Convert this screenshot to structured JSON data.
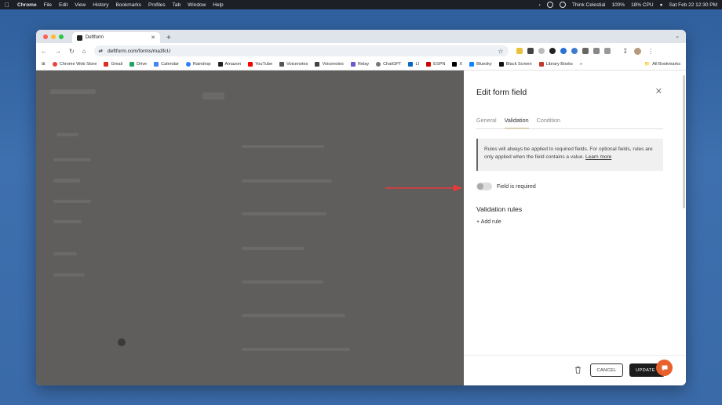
{
  "menubar": {
    "app": "Chrome",
    "items": [
      "File",
      "Edit",
      "View",
      "History",
      "Bookmarks",
      "Profiles",
      "Tab",
      "Window",
      "Help"
    ],
    "user": "Think Celestial",
    "battery": "100%",
    "cpu": "18% CPU",
    "datetime": "Sat Feb 22  12:30 PM"
  },
  "browser": {
    "tab_title": "Deftform",
    "url": "deftform.com/forms/ma3fcU",
    "bookmarks": [
      {
        "label": "Chrome Web Store",
        "color": "#e8453c"
      },
      {
        "label": "Gmail",
        "color": "#d93025"
      },
      {
        "label": "Drive",
        "color": "#1fa463"
      },
      {
        "label": "Calendar",
        "color": "#4285f4"
      },
      {
        "label": "Raindrop",
        "color": "#2d7ff9"
      },
      {
        "label": "Amazon",
        "color": "#222222"
      },
      {
        "label": "YouTube",
        "color": "#ff0000"
      },
      {
        "label": "Voicenotes",
        "color": "#555555"
      },
      {
        "label": "Voicenotes",
        "color": "#444444"
      },
      {
        "label": "Relay",
        "color": "#6a5acd"
      },
      {
        "label": "ChatGPT",
        "color": "#777777"
      },
      {
        "label": "LI",
        "color": "#0a66c2"
      },
      {
        "label": "ESPN",
        "color": "#d00000"
      },
      {
        "label": "X",
        "color": "#000000"
      },
      {
        "label": "Bluesky",
        "color": "#1185fe"
      },
      {
        "label": "Black Screen",
        "color": "#111111"
      },
      {
        "label": "Library Books",
        "color": "#c0392b"
      }
    ],
    "all_bookmarks": "All Bookmarks"
  },
  "panel": {
    "title": "Edit form field",
    "tabs": [
      {
        "label": "General",
        "active": false
      },
      {
        "label": "Validation",
        "active": true
      },
      {
        "label": "Condition",
        "active": false
      }
    ],
    "notice_text": "Rules will always be applied to required fields. For optional fields, rules are only applied when the field contains a value. ",
    "notice_link": "Learn more",
    "toggle_label": "Field is required",
    "toggle_on": false,
    "section_title": "Validation rules",
    "add_rule": "+ Add rule",
    "cancel": "CANCEL",
    "update": "UPDATE"
  },
  "colors": {
    "accent_tab": "#d8c08a",
    "chat_bubble": "#e8602c",
    "arrow": "#e83a3a"
  }
}
